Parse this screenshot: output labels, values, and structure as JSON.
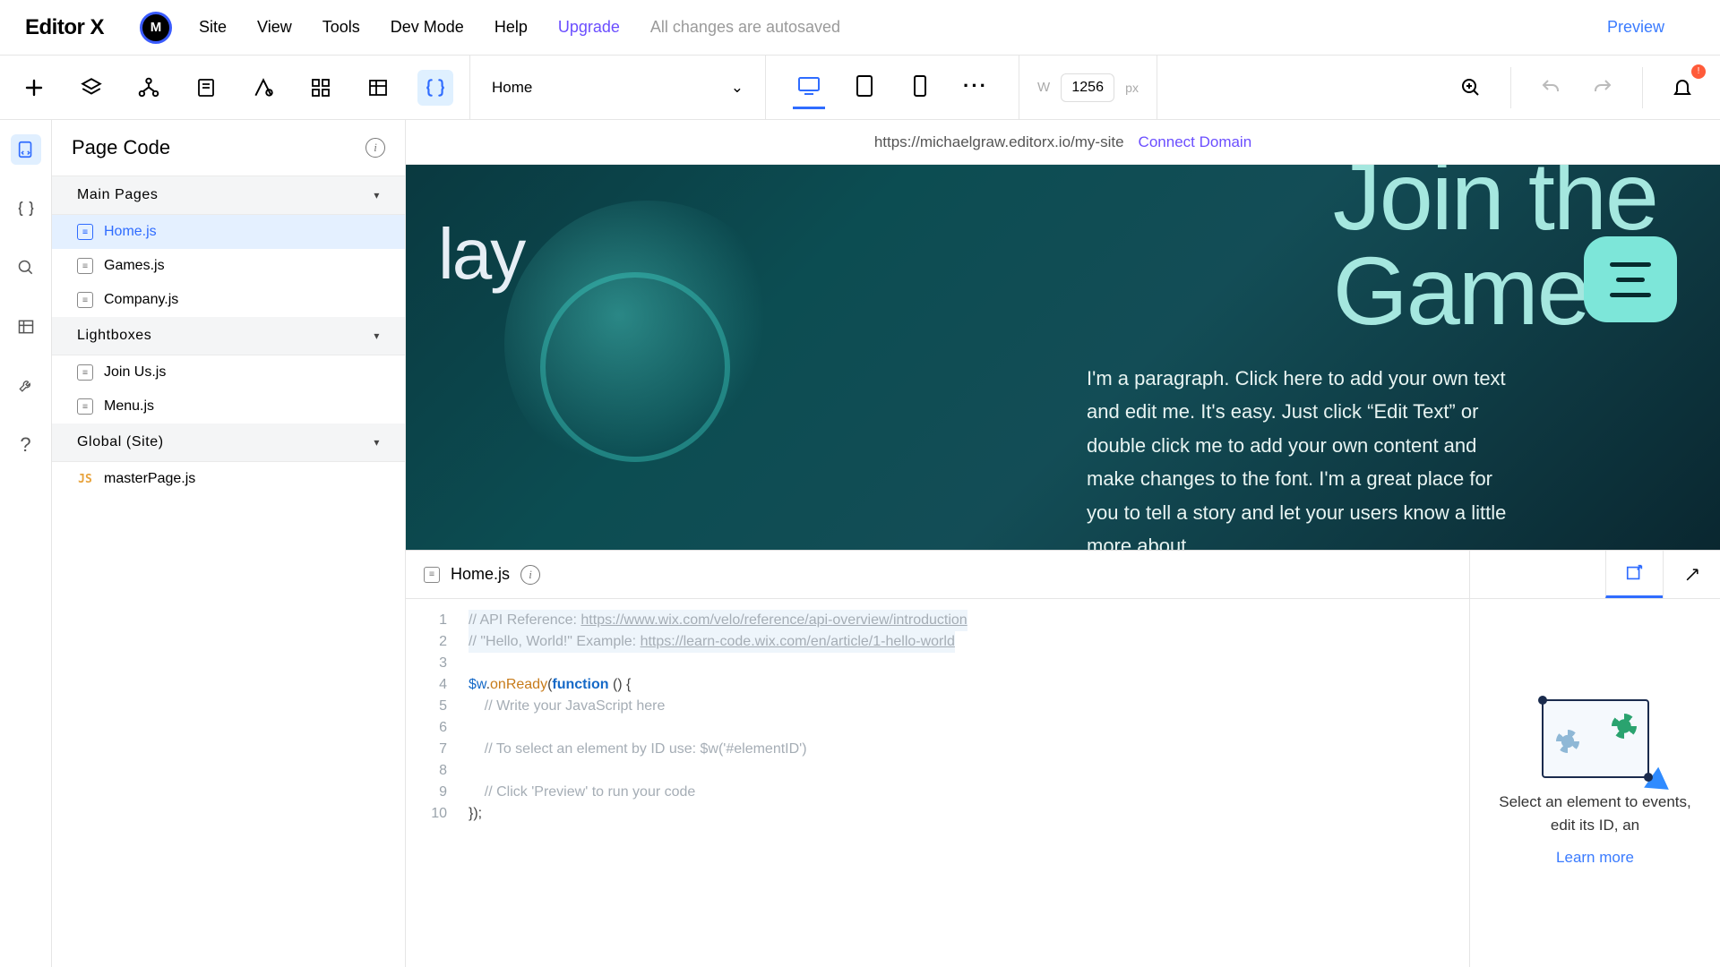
{
  "menubar": {
    "logo": "Editor X",
    "avatar_letter": "M",
    "items": [
      "Site",
      "View",
      "Tools",
      "Dev Mode",
      "Help"
    ],
    "upgrade": "Upgrade",
    "autosave": "All changes are autosaved",
    "preview": "Preview"
  },
  "toolbar": {
    "page_selector": "Home",
    "width_label": "W",
    "width_value": "1256",
    "width_unit": "px",
    "notif_count": "!"
  },
  "sidebar": {
    "title": "Page Code",
    "sections": {
      "main_pages": {
        "label": "Main Pages",
        "files": [
          "Home.js",
          "Games.js",
          "Company.js"
        ],
        "active": 0
      },
      "lightboxes": {
        "label": "Lightboxes",
        "files": [
          "Join Us.js",
          "Menu.js"
        ]
      },
      "global": {
        "label": "Global (Site)",
        "files": [
          "masterPage.js"
        ]
      }
    }
  },
  "urlbar": {
    "url": "https://michaelgraw.editorx.io/my-site",
    "connect": "Connect Domain"
  },
  "hero": {
    "partial_left": "lay",
    "title_line1": "Join the",
    "title_line2": "Game",
    "para": "I'm a paragraph. Click here to add your own text and edit me. It's easy. Just click “Edit Text” or double click me to add your own content and make changes to the font. I'm a great place for you to tell a story and let your users know a little more about"
  },
  "code": {
    "tab_label": "Home.js",
    "lines": [
      "1",
      "2",
      "3",
      "4",
      "5",
      "6",
      "7",
      "8",
      "9",
      "10"
    ],
    "l1_prefix": "// API Reference: ",
    "l1_link": "https://www.wix.com/velo/reference/api-overview/introduction",
    "l2_prefix": "// \"Hello, World!\" Example: ",
    "l2_link": "https://learn-code.wix.com/en/article/1-hello-world",
    "l4_a": "$w",
    "l4_b": ".",
    "l4_c": "onReady",
    "l4_d": "(",
    "l4_e": "function",
    "l4_f": " () {",
    "l5": "    // Write your JavaScript here",
    "l7": "    // To select an element by ID use: $w('#elementID')",
    "l9": "    // Click 'Preview' to run your code",
    "l10": "});"
  },
  "props": {
    "text": "Select an element to events, edit its ID, an",
    "link": "Learn more"
  }
}
